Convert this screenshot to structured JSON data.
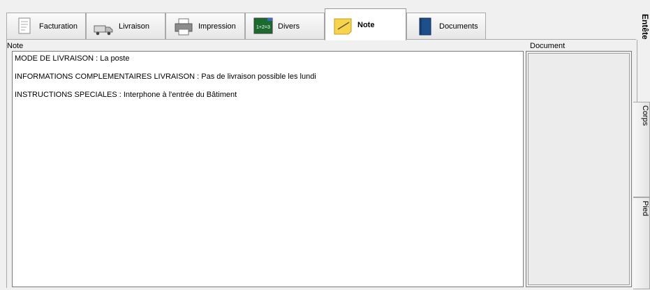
{
  "tabs": [
    {
      "label": "Facturation",
      "icon": "invoice-icon"
    },
    {
      "label": "Livraison",
      "icon": "truck-icon"
    },
    {
      "label": "Impression",
      "icon": "printer-icon"
    },
    {
      "label": "Divers",
      "icon": "chalkboard-icon"
    },
    {
      "label": "Note",
      "icon": "sticky-note-icon"
    },
    {
      "label": "Documents",
      "icon": "book-icon"
    }
  ],
  "active_tab": "Note",
  "note": {
    "label": "Note",
    "lines": [
      "MODE DE LIVRAISON : La poste",
      "INFORMATIONS COMPLEMENTAIRES LIVRAISON : Pas de livraison possible les lundi",
      "INSTRUCTIONS SPECIALES : Interphone à l'entrée du Bâtiment"
    ]
  },
  "document": {
    "label": "Document"
  },
  "side": {
    "title": "Entête",
    "tabs": [
      {
        "label": "Corps"
      },
      {
        "label": "Pied"
      }
    ]
  },
  "colors": {
    "background": "#f0f0f0",
    "border": "#a9a9a9",
    "note_bg": "#ffffff"
  }
}
